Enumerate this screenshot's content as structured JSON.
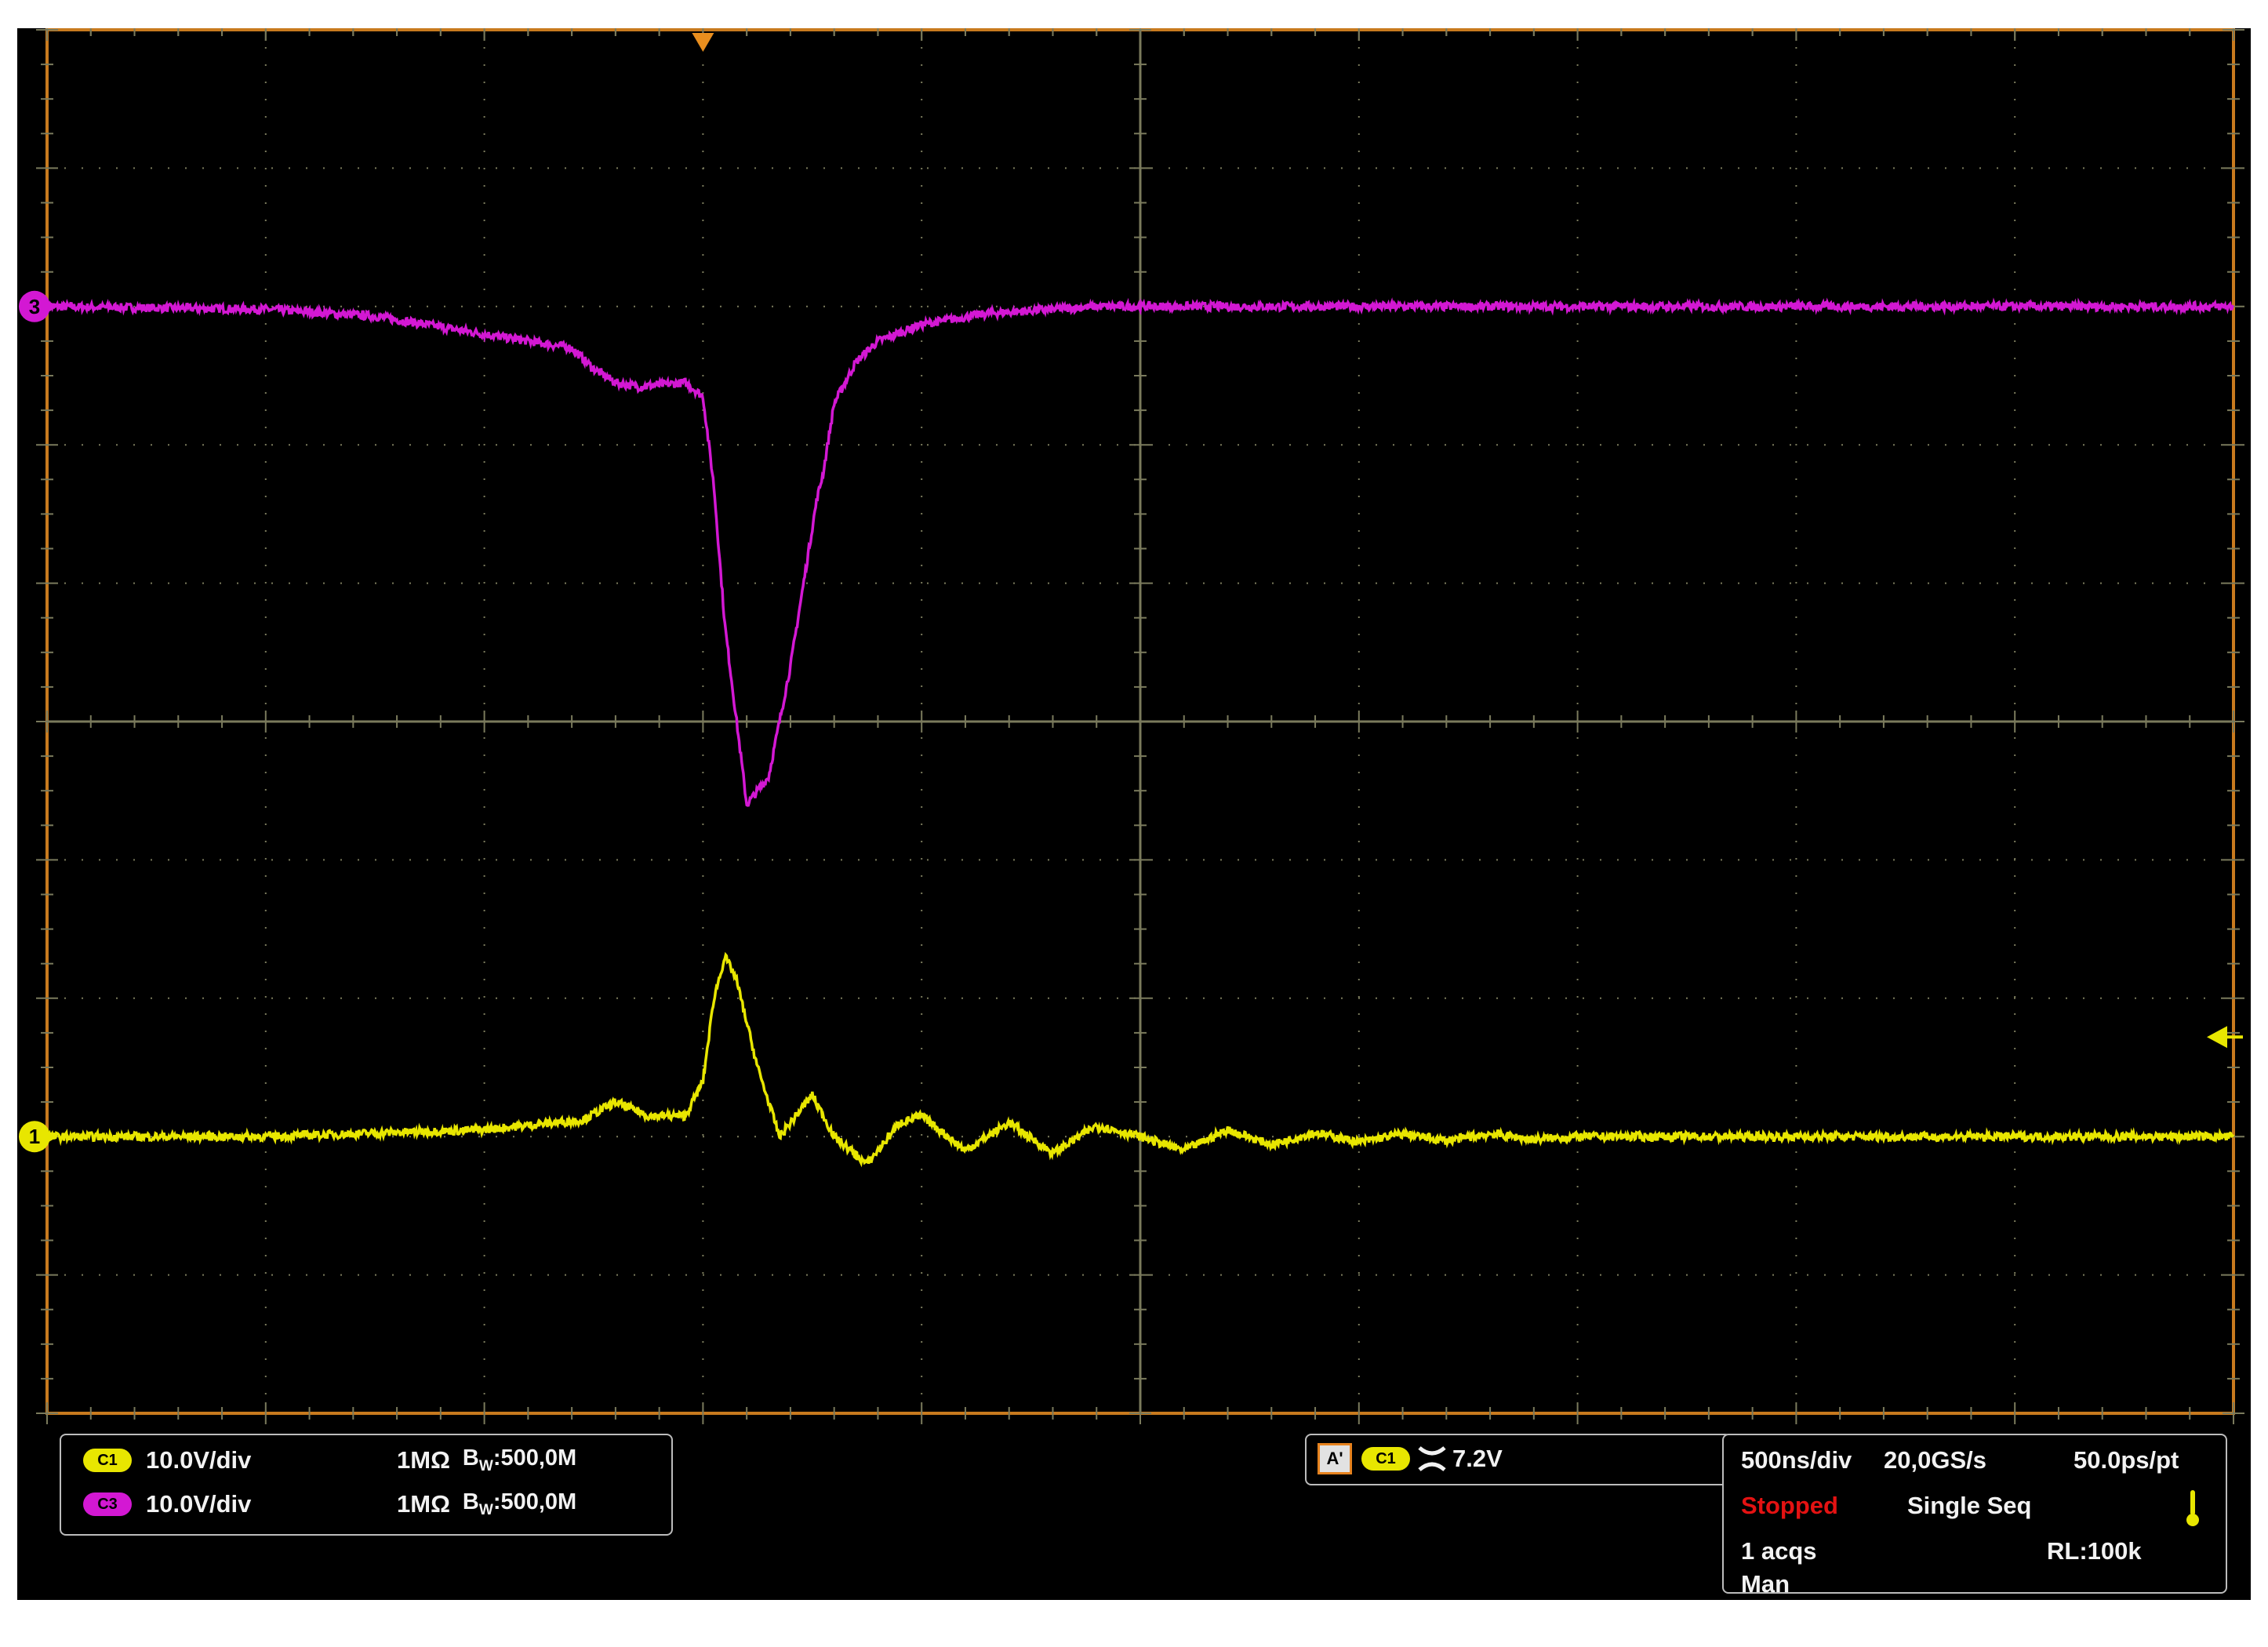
{
  "colors": {
    "background": "#000000",
    "border": "#c87a1e",
    "grid": "#7a7a5c",
    "ch1": "#e8e600",
    "ch3": "#d318d3",
    "stopped": "#e41212",
    "text": "#f2f2f2"
  },
  "scope": {
    "markers": {
      "ch3": "3",
      "ch1": "1",
      "trigger_position_icon": "trigger-position-marker",
      "trigger_level_icon": "trigger-level-arrow"
    },
    "channel_panel": {
      "channels": [
        {
          "badge": "C1",
          "scale": "10.0V/div",
          "impedance": "1MΩ",
          "bw_label": "B",
          "bw_sub": "W",
          "bw_value": ":500,0M"
        },
        {
          "badge": "C3",
          "scale": "10.0V/div",
          "impedance": "1MΩ",
          "bw_label": "B",
          "bw_sub": "W",
          "bw_value": ":500,0M"
        }
      ]
    },
    "trigger_panel": {
      "mode": "A'",
      "source": "C1",
      "slope_icon": "trigger-slope-icon",
      "level": "7.2V"
    },
    "acquisition_panel": {
      "timebase": "500ns/div",
      "sample_rate": "20,0GS/s",
      "resolution": "50.0ps/pt",
      "status": "Stopped",
      "mode": "Single Seq",
      "acqs": "1 acqs",
      "record_length": "RL:100k",
      "horizontal_mode": "Man"
    }
  },
  "chart_data": {
    "type": "line",
    "x_unit": "div",
    "y_unit": "div",
    "xlim": [
      0,
      10
    ],
    "ylim": [
      -5,
      5
    ],
    "grid": true,
    "series": [
      {
        "name": "C3",
        "x": [
          0,
          1.0,
          1.5,
          2.0,
          2.4,
          2.5,
          2.6,
          2.7,
          2.92,
          3.0,
          3.05,
          3.1,
          3.2,
          3.3,
          3.4,
          3.45,
          3.5,
          3.52,
          3.55,
          3.6,
          3.7,
          3.8,
          4.0,
          4.3,
          4.6,
          4.8,
          5.0,
          6.0,
          7.0,
          8.0,
          9.0,
          10.0
        ],
        "y": [
          3.0,
          2.98,
          2.93,
          2.8,
          2.7,
          2.55,
          2.45,
          2.42,
          2.45,
          2.35,
          1.7,
          0.7,
          -0.6,
          -0.4,
          0.4,
          0.9,
          1.4,
          1.6,
          1.8,
          2.3,
          2.6,
          2.75,
          2.87,
          2.95,
          2.98,
          3.0,
          3.0,
          3.0,
          3.0,
          3.0,
          3.0,
          3.0
        ]
      },
      {
        "name": "C1",
        "x": [
          0,
          1.0,
          2.0,
          2.45,
          2.6,
          2.75,
          2.92,
          3.0,
          3.05,
          3.1,
          3.15,
          3.25,
          3.35,
          3.5,
          3.6,
          3.75,
          3.9,
          4.0,
          4.2,
          4.4,
          4.6,
          4.8,
          5.0,
          5.2,
          5.4,
          5.6,
          5.8,
          6.0,
          6.2,
          6.4,
          6.6,
          6.8,
          7.0,
          7.4,
          7.8,
          8.5,
          9.0,
          10.0
        ],
        "y": [
          -3.0,
          -3.0,
          -2.95,
          -2.88,
          -2.75,
          -2.85,
          -2.85,
          -2.6,
          -2.0,
          -1.7,
          -1.85,
          -2.5,
          -3.0,
          -2.7,
          -3.0,
          -3.2,
          -2.9,
          -2.85,
          -3.1,
          -2.9,
          -3.12,
          -2.92,
          -3.0,
          -3.1,
          -2.95,
          -3.06,
          -2.97,
          -3.04,
          -2.98,
          -3.03,
          -2.98,
          -3.02,
          -3.0,
          -3.0,
          -3.0,
          -3.0,
          -3.0,
          -3.0
        ]
      }
    ],
    "trigger_level_y": -2.28,
    "trigger_time_x": 3.0
  }
}
